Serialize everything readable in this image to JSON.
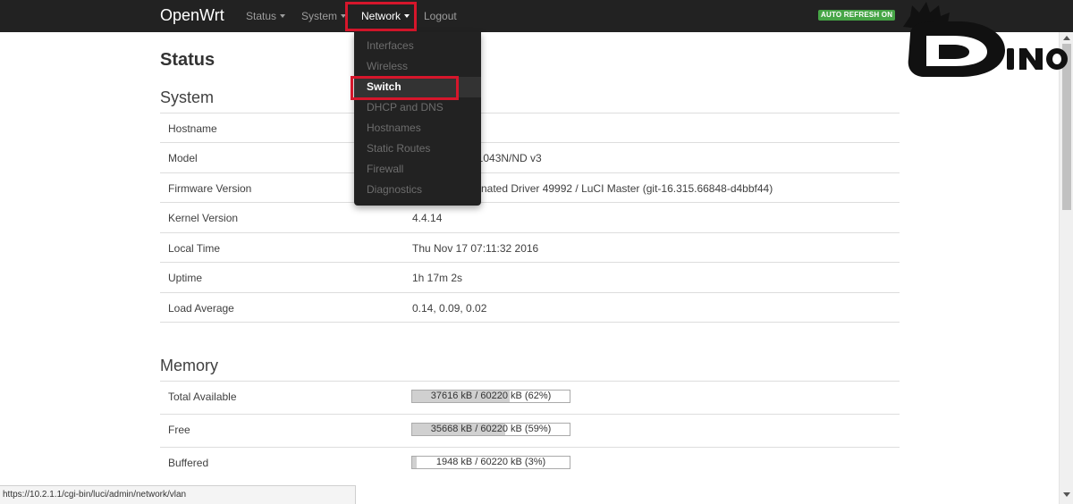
{
  "navbar": {
    "brand": "OpenWrt",
    "items": [
      {
        "label": "Status"
      },
      {
        "label": "System"
      },
      {
        "label": "Network"
      },
      {
        "label": "Logout"
      }
    ],
    "refresh_badge": "AUTO REFRESH ON"
  },
  "network_menu": {
    "items": [
      {
        "label": "Interfaces"
      },
      {
        "label": "Wireless"
      },
      {
        "label": "Switch",
        "active": true
      },
      {
        "label": "DHCP and DNS"
      },
      {
        "label": "Hostnames"
      },
      {
        "label": "Static Routes"
      },
      {
        "label": "Firewall"
      },
      {
        "label": "Diagnostics"
      }
    ]
  },
  "page": {
    "title": "Status"
  },
  "system": {
    "title": "System",
    "rows": [
      {
        "label": "Hostname",
        "value": ""
      },
      {
        "label": "Model",
        "value": "21043N/ND v3"
      },
      {
        "label": "Firmware Version",
        "value": "nated Driver 49992 / LuCI Master (git-16.315.66848-d4bbf44)"
      },
      {
        "label": "Kernel Version",
        "value": "4.4.14"
      },
      {
        "label": "Local Time",
        "value": "Thu Nov 17 07:11:32 2016"
      },
      {
        "label": "Uptime",
        "value": "1h 17m 2s"
      },
      {
        "label": "Load Average",
        "value": "0.14, 0.09, 0.02"
      }
    ]
  },
  "memory": {
    "title": "Memory",
    "rows": [
      {
        "label": "Total Available",
        "bar_text": "37616 kB / 60220 kB (62%)",
        "percent": 62
      },
      {
        "label": "Free",
        "bar_text": "35668 kB / 60220 kB (59%)",
        "percent": 59
      },
      {
        "label": "Buffered",
        "bar_text": "1948 kB / 60220 kB (3%)",
        "percent": 3
      }
    ]
  },
  "statusbar": {
    "url": "https://10.2.1.1/cgi-bin/luci/admin/network/vlan"
  },
  "logo": {
    "text": "DINO"
  },
  "colors": {
    "navbar_bg": "#222222",
    "highlight_box": "#d6162b",
    "badge_green": "#46a546",
    "progress_fill": "#d0d0d0"
  }
}
